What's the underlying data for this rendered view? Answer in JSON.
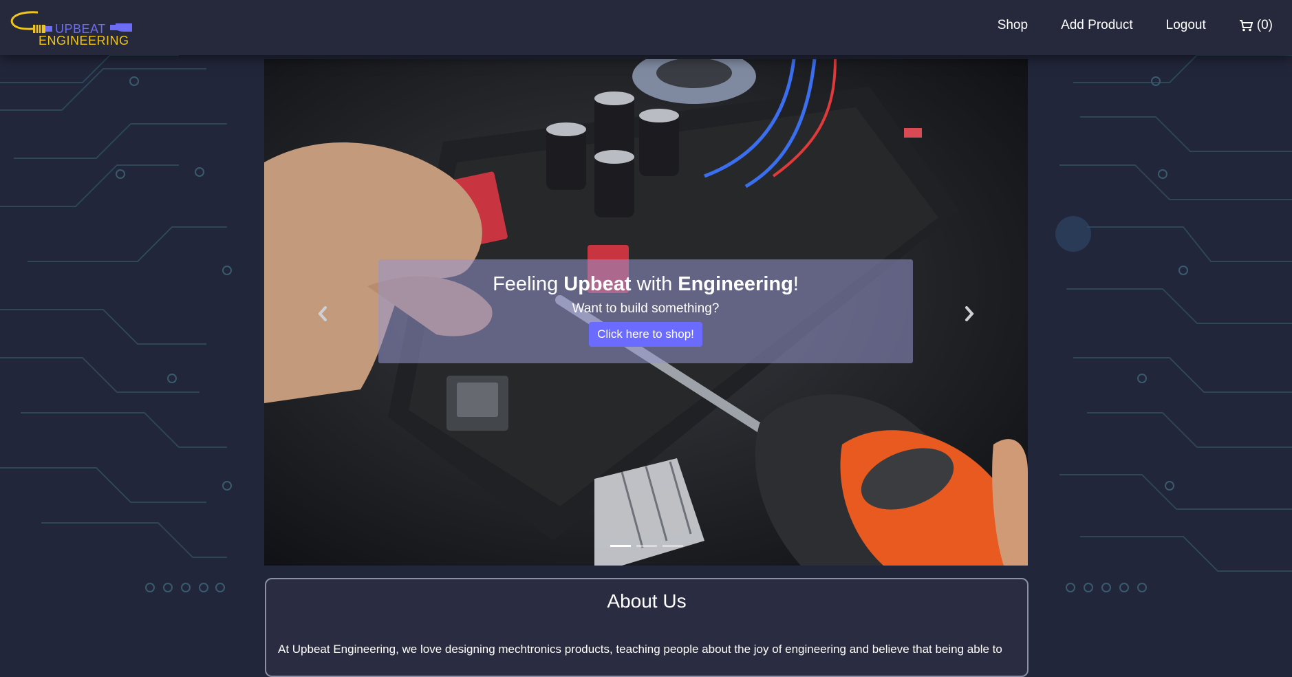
{
  "brand": {
    "line1": "UPBEAT",
    "line2": "ENGINEERING"
  },
  "nav": {
    "shop": "Shop",
    "add_product": "Add Product",
    "logout": "Logout",
    "cart": "(0)"
  },
  "carousel": {
    "title_pre": "Feeling ",
    "title_b1": "Upbeat",
    "title_mid": " with ",
    "title_b2": "Engineering",
    "title_post": "!",
    "subtitle": "Want to build something?",
    "button": "Click here to shop!",
    "slide_count": 3,
    "active_slide": 1
  },
  "about": {
    "title": "About Us",
    "text": "At Upbeat Engineering, we love designing mechtronics products, teaching people about the joy of engineering and believe that being able to"
  },
  "colors": {
    "background": "#22263a",
    "accent": "#6b6bff",
    "logo_blue": "#6c6cf5",
    "logo_yellow": "#f0c419"
  },
  "icons": [
    "cart-icon",
    "chevron-left-icon",
    "chevron-right-icon",
    "cable-icon"
  ]
}
